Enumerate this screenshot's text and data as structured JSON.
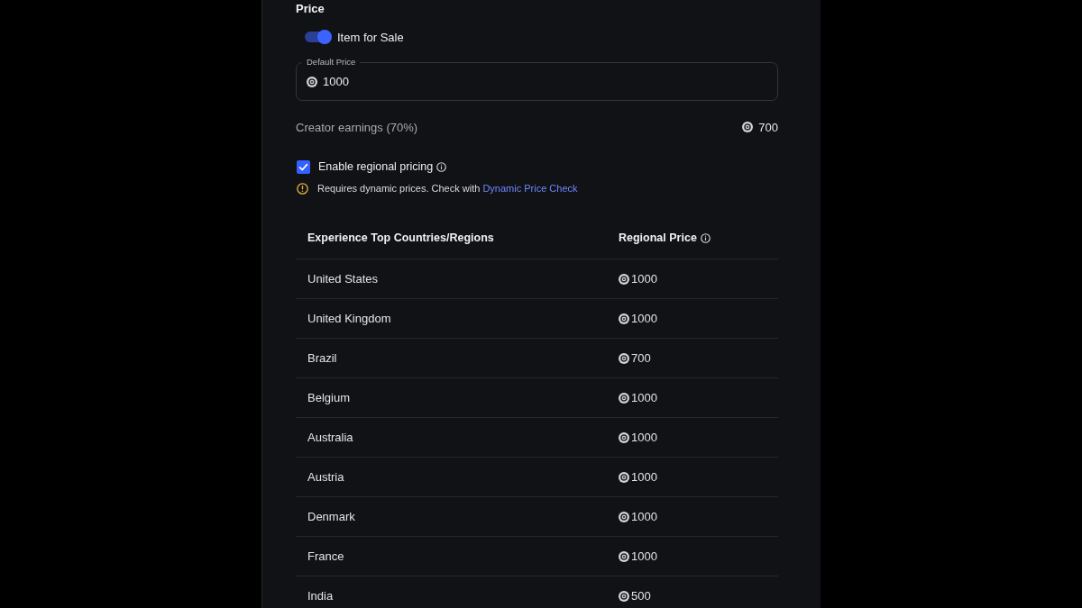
{
  "section_title": "Price",
  "item_for_sale": {
    "label": "Item for Sale",
    "on": true
  },
  "default_price": {
    "label": "Default Price",
    "value": "1000"
  },
  "creator_earnings": {
    "label": "Creator earnings (70%)",
    "value": "700"
  },
  "regional_pricing": {
    "label": "Enable regional pricing",
    "checked": true
  },
  "notice": {
    "text": "Requires dynamic prices. Check with",
    "link": "Dynamic Price Check"
  },
  "table": {
    "columns": [
      "Experience Top Countries/Regions",
      "Regional Price"
    ],
    "rows": [
      {
        "country": "United States",
        "price": "1000"
      },
      {
        "country": "United Kingdom",
        "price": "1000"
      },
      {
        "country": "Brazil",
        "price": "700"
      },
      {
        "country": "Belgium",
        "price": "1000"
      },
      {
        "country": "Australia",
        "price": "1000"
      },
      {
        "country": "Austria",
        "price": "1000"
      },
      {
        "country": "Denmark",
        "price": "1000"
      },
      {
        "country": "France",
        "price": "1000"
      },
      {
        "country": "India",
        "price": "500"
      }
    ]
  }
}
